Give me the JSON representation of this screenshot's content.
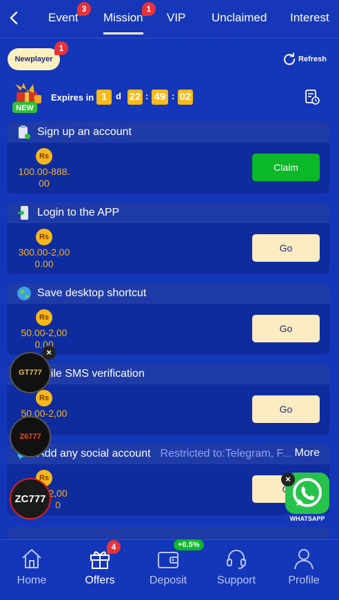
{
  "tabs": [
    {
      "label": "Event",
      "badge": "3"
    },
    {
      "label": "Mission",
      "badge": "1"
    },
    {
      "label": "VIP"
    },
    {
      "label": "Unclaimed"
    },
    {
      "label": "Interest"
    }
  ],
  "newplayer": {
    "label": "Newplayer",
    "badge": "1"
  },
  "refresh_label": "Refresh",
  "gift_badge": "NEW",
  "expires": {
    "label": "Expires in",
    "days": "1",
    "day_unit": "d",
    "hours": "22",
    "minutes": "49",
    "seconds": "02"
  },
  "currency": "Rs",
  "missions": [
    {
      "title": "Sign up an account",
      "amount_line1": "100.00-888.",
      "amount_line2": "00",
      "action": "Claim"
    },
    {
      "title": "Login to the APP",
      "amount_line1": "300.00-2,00",
      "amount_line2": "0.00",
      "action": "Go"
    },
    {
      "title": "Save desktop shortcut",
      "amount_line1": "50.00-2,00",
      "amount_line2": "0.00",
      "action": "Go"
    },
    {
      "title": "obile SMS verification",
      "amount_line1": "50.00-2,00",
      "amount_line2": "0",
      "action": "Go"
    },
    {
      "title": "Add any social account",
      "restriction": "Restricted to:Telegram, F...",
      "more": "More",
      "amount_line1": "2,00",
      "amount_line2": "0",
      "action": "G"
    }
  ],
  "ads": [
    {
      "label": "GT777"
    },
    {
      "label": "Z6777"
    },
    {
      "label": "ZC777"
    }
  ],
  "whatsapp_label": "WHATSAPP",
  "close_glyph": "×",
  "bottom_nav": [
    {
      "label": "Home"
    },
    {
      "label": "Offers",
      "badge": "4"
    },
    {
      "label": "Deposit",
      "bonus": "+0.5%"
    },
    {
      "label": "Support"
    },
    {
      "label": "Profile"
    }
  ],
  "colors": {
    "background": "#1436b8",
    "card": "#0f2c9f",
    "accent_yellow": "#f9ba1a",
    "claim_green": "#0ab828",
    "go_button": "#fdebc1",
    "badge_red": "#e6323a"
  }
}
